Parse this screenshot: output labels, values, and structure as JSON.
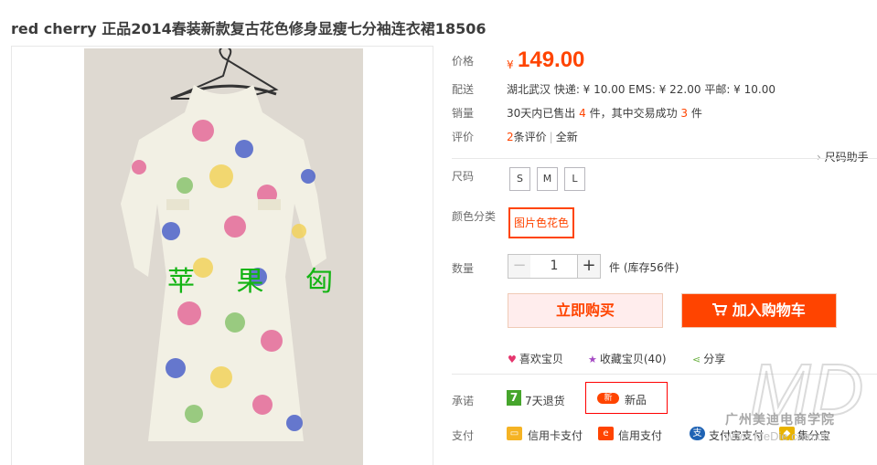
{
  "title": "red cherry 正品2014春装新款复古花色修身显瘦七分袖连衣裙18506",
  "image_watermark": "苹 果 匈",
  "price": {
    "label": "价格",
    "currency": "¥",
    "value": "149.00"
  },
  "shipping": {
    "label": "配送",
    "text": "湖北武汉 快递: ¥ 10.00  EMS: ¥ 22.00  平邮: ¥ 10.00"
  },
  "sales": {
    "label": "销量",
    "prefix": "30天内已售出",
    "sold": "4",
    "mid": "件，其中交易成功",
    "success": "3",
    "suffix": "件"
  },
  "reviews": {
    "label": "评价",
    "count": "2",
    "text": "条评价",
    "sep": "|",
    "all": "全新"
  },
  "size_helper": "尺码助手",
  "size": {
    "label": "尺码",
    "options": [
      "S",
      "M",
      "L"
    ]
  },
  "color": {
    "label": "颜色分类",
    "selected": "图片色花色"
  },
  "quantity": {
    "label": "数量",
    "minus": "−",
    "value": "1",
    "plus": "+",
    "stock": "件 (库存56件)"
  },
  "buttons": {
    "buy": "立即购买",
    "cart": "加入购物车"
  },
  "actions": {
    "like": "喜欢宝贝",
    "fav": "收藏宝贝(40)",
    "share": "分享"
  },
  "promise": {
    "label": "承诺",
    "seven_icon": "7",
    "seven_days": "7天退货",
    "new_badge": "新",
    "new": "新品"
  },
  "pay": {
    "label": "支付",
    "credit": "信用卡支付",
    "credit_pay": "信用支付",
    "alipay_icon": "支",
    "alipay": "支付宝支付",
    "jifen": "集分宝"
  },
  "site_watermark": {
    "name": "广州美迪电商学院",
    "url": "www.MeDie.com.cn"
  },
  "colors": {
    "accent": "#ff4400",
    "label": "#6c6c6c",
    "green": "#46a52c"
  }
}
